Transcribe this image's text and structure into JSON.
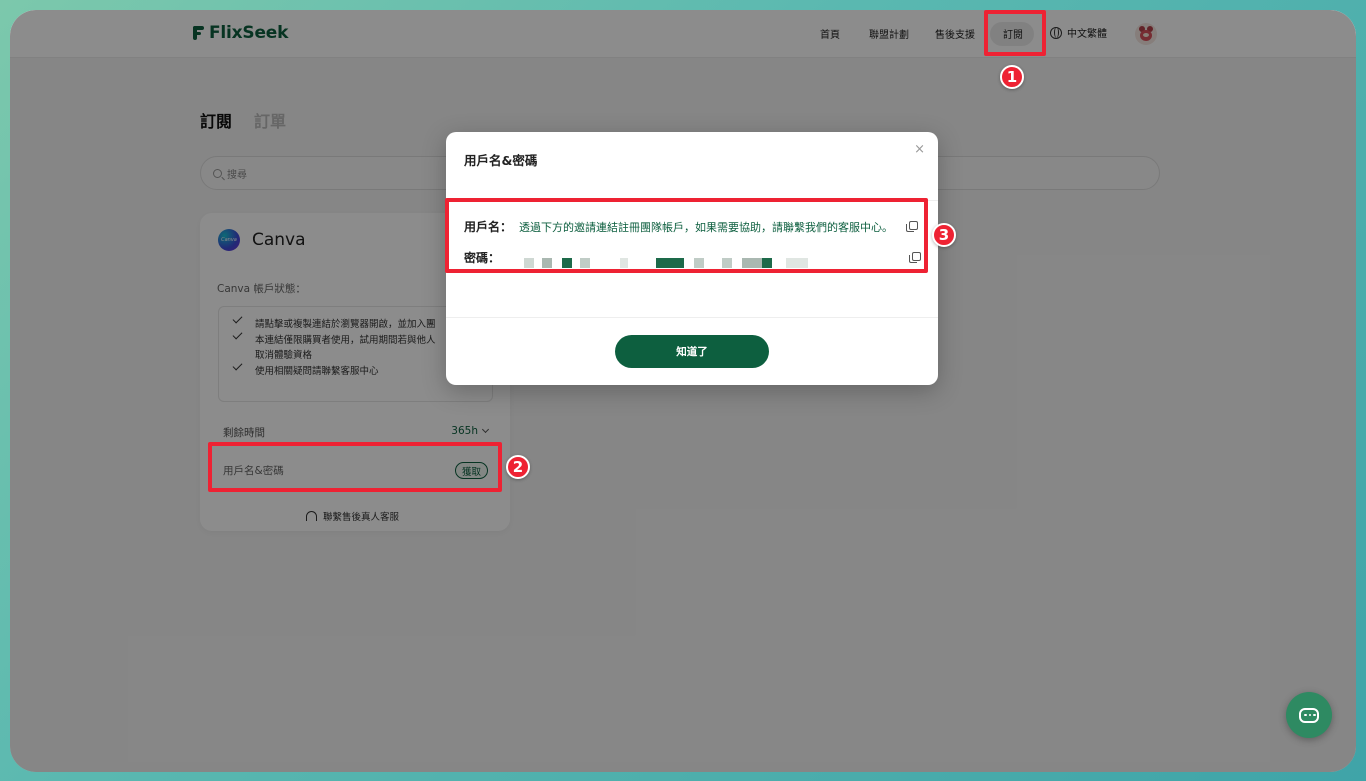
{
  "header": {
    "brand": "FlixSeek",
    "nav": [
      "首頁",
      "聯盟計劃",
      "售後支援",
      "訂閱"
    ],
    "language": "中文繁體"
  },
  "page": {
    "tabs": [
      "訂閱",
      "訂單"
    ],
    "search_placeholder": "搜尋"
  },
  "card": {
    "product": "Canva",
    "logo_text": "Canva",
    "status_label": "Canva 帳戶狀態：",
    "status_lines": [
      "請點擊或複製連結於瀏覽器開啟，並加入團",
      "本連結僅限購買者使用，試用期間若與他人",
      "取消體驗資格",
      "使用相關疑問請聯繫客服中心"
    ],
    "remaining_label": "剩餘時間",
    "remaining_value": "365h",
    "credentials_label": "用戶名&密碼",
    "get_button": "獲取",
    "contact": "聯繫售後真人客服"
  },
  "modal": {
    "title": "用戶名&密碼",
    "close": "×",
    "username_label": "用戶名：",
    "username_value": "透過下方的邀請連結註冊團隊帳戶，如果需要協助，請聯繫我們的客服中心。",
    "password_label": "密碼：",
    "confirm_button": "知道了"
  },
  "annotations": [
    "1",
    "2",
    "3"
  ],
  "colors": {
    "brand_green": "#0d5f3f",
    "annotation_red": "#ee2233"
  }
}
